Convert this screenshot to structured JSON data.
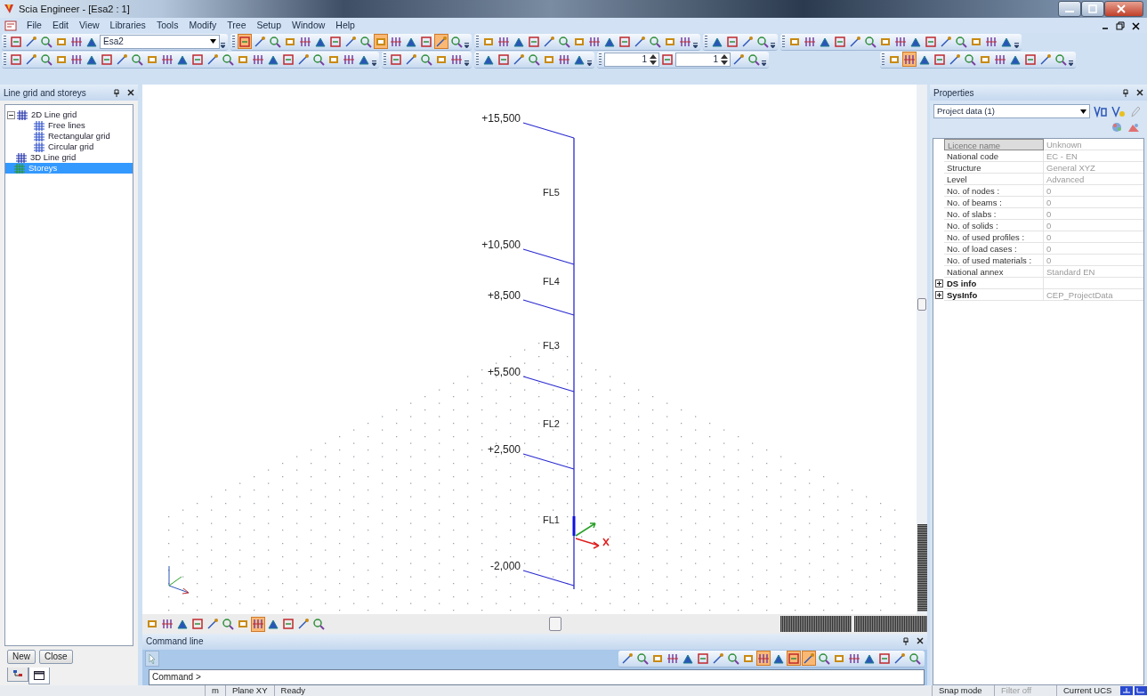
{
  "window": {
    "title": "Scia Engineer - [Esa2 : 1]"
  },
  "menu": [
    "File",
    "Edit",
    "View",
    "Libraries",
    "Tools",
    "Modify",
    "Tree",
    "Setup",
    "Window",
    "Help"
  ],
  "toolbar_rows": [
    {
      "groups": [
        {
          "items": [
            {
              "kind": "button",
              "on": false
            },
            {
              "kind": "button",
              "on": false
            },
            {
              "kind": "button",
              "on": false
            },
            {
              "kind": "button",
              "on": false
            },
            {
              "kind": "button",
              "on": false
            },
            {
              "kind": "button",
              "on": false
            },
            {
              "kind": "combo",
              "value": "Esa2"
            }
          ]
        },
        {
          "items": [
            {
              "kind": "button",
              "on": true
            },
            {
              "kind": "button",
              "on": false
            },
            {
              "kind": "button",
              "on": false
            },
            {
              "kind": "button",
              "on": false
            },
            {
              "kind": "button",
              "on": false
            },
            {
              "kind": "button",
              "on": false
            },
            {
              "kind": "button",
              "on": false
            },
            {
              "kind": "button",
              "on": false
            },
            {
              "kind": "button",
              "on": false
            },
            {
              "kind": "button",
              "on": true
            },
            {
              "kind": "button",
              "on": false
            },
            {
              "kind": "button",
              "on": false
            },
            {
              "kind": "button",
              "on": false
            },
            {
              "kind": "button",
              "on": true
            },
            {
              "kind": "button",
              "on": false
            }
          ]
        },
        {
          "items": [
            {
              "kind": "button",
              "on": false
            },
            {
              "kind": "button",
              "on": false
            },
            {
              "kind": "button",
              "on": false
            },
            {
              "kind": "button",
              "on": false
            },
            {
              "kind": "button",
              "on": false
            },
            {
              "kind": "button",
              "on": false
            },
            {
              "kind": "button",
              "on": false
            },
            {
              "kind": "button",
              "on": false
            },
            {
              "kind": "button",
              "on": false
            },
            {
              "kind": "button",
              "on": false
            },
            {
              "kind": "button",
              "on": false
            },
            {
              "kind": "button",
              "on": false
            },
            {
              "kind": "button",
              "on": false
            },
            {
              "kind": "button",
              "on": false
            }
          ]
        },
        {
          "items": [
            {
              "kind": "button",
              "on": false
            },
            {
              "kind": "button",
              "on": false
            },
            {
              "kind": "button",
              "on": false
            },
            {
              "kind": "button",
              "on": false
            }
          ]
        },
        {
          "items": [
            {
              "kind": "button",
              "on": false
            },
            {
              "kind": "button",
              "on": false
            },
            {
              "kind": "button",
              "on": false
            },
            {
              "kind": "button",
              "on": false
            },
            {
              "kind": "button",
              "on": false
            },
            {
              "kind": "button",
              "on": false
            },
            {
              "kind": "button",
              "on": false
            },
            {
              "kind": "button",
              "on": false
            },
            {
              "kind": "button",
              "on": false
            },
            {
              "kind": "button",
              "on": false
            },
            {
              "kind": "button",
              "on": false
            },
            {
              "kind": "button",
              "on": false
            },
            {
              "kind": "button",
              "on": false
            },
            {
              "kind": "button",
              "on": false
            },
            {
              "kind": "button",
              "on": false
            }
          ]
        }
      ]
    },
    {
      "groups": [
        {
          "items": [
            {
              "kind": "button",
              "on": false
            },
            {
              "kind": "button",
              "on": false
            },
            {
              "kind": "button",
              "on": false
            },
            {
              "kind": "button",
              "on": false
            },
            {
              "kind": "button",
              "on": false
            },
            {
              "kind": "button",
              "on": false
            },
            {
              "kind": "button",
              "on": false
            },
            {
              "kind": "button",
              "on": false
            },
            {
              "kind": "button",
              "on": false
            },
            {
              "kind": "button",
              "on": false
            },
            {
              "kind": "button",
              "on": false
            },
            {
              "kind": "button",
              "on": false
            },
            {
              "kind": "button",
              "on": false
            },
            {
              "kind": "button",
              "on": false
            },
            {
              "kind": "button",
              "on": false
            },
            {
              "kind": "button",
              "on": false
            },
            {
              "kind": "button",
              "on": false
            },
            {
              "kind": "button",
              "on": false
            },
            {
              "kind": "button",
              "on": false
            },
            {
              "kind": "button",
              "on": false
            },
            {
              "kind": "button",
              "on": false
            },
            {
              "kind": "button",
              "on": false
            },
            {
              "kind": "button",
              "on": false
            },
            {
              "kind": "button",
              "on": false
            }
          ]
        },
        {
          "items": [
            {
              "kind": "button",
              "on": false
            },
            {
              "kind": "button",
              "on": false
            },
            {
              "kind": "button",
              "on": false
            },
            {
              "kind": "button",
              "on": false
            },
            {
              "kind": "button",
              "on": false
            }
          ]
        },
        {
          "items": [
            {
              "kind": "button",
              "on": false
            },
            {
              "kind": "button",
              "on": false
            },
            {
              "kind": "button",
              "on": false
            },
            {
              "kind": "button",
              "on": false
            },
            {
              "kind": "button",
              "on": false
            },
            {
              "kind": "button",
              "on": false
            },
            {
              "kind": "button",
              "on": false
            }
          ]
        },
        {
          "items": [
            {
              "kind": "spinner",
              "value": "1"
            },
            {
              "kind": "button",
              "on": false
            },
            {
              "kind": "spinner",
              "value": "1"
            },
            {
              "kind": "button",
              "on": false
            },
            {
              "kind": "button",
              "on": false
            }
          ]
        },
        {
          "items": [
            {
              "kind": "button",
              "on": false
            },
            {
              "kind": "button",
              "on": true
            },
            {
              "kind": "button",
              "on": false
            },
            {
              "kind": "button",
              "on": false
            },
            {
              "kind": "button",
              "on": false
            },
            {
              "kind": "button",
              "on": false
            },
            {
              "kind": "button",
              "on": false
            },
            {
              "kind": "button",
              "on": false
            },
            {
              "kind": "button",
              "on": false
            },
            {
              "kind": "button",
              "on": false
            },
            {
              "kind": "button",
              "on": false
            },
            {
              "kind": "button",
              "on": false
            }
          ]
        }
      ]
    }
  ],
  "left_panel": {
    "title": "Line grid and storeys",
    "tree": [
      {
        "label": "2D Line grid",
        "expanded": true,
        "selected": false,
        "children": [
          {
            "label": "Free lines",
            "selected": false
          },
          {
            "label": "Rectangular grid",
            "selected": false
          },
          {
            "label": "Circular grid",
            "selected": false
          }
        ]
      },
      {
        "label": "3D Line grid",
        "selected": false
      },
      {
        "label": "Storeys",
        "selected": true
      }
    ],
    "buttons": [
      "New",
      "Close"
    ],
    "tabs": [
      {
        "selected": false
      },
      {
        "selected": true
      }
    ]
  },
  "canvas": {
    "levels": [
      {
        "elevation": "+15,500"
      },
      {
        "elevation": "+10,500"
      },
      {
        "elevation": "+8,500"
      },
      {
        "elevation": "+5,500"
      },
      {
        "elevation": "+2,500"
      },
      {
        "elevation": "-2,000"
      }
    ],
    "storeys": [
      "FL5",
      "FL4",
      "FL3",
      "FL2",
      "FL1"
    ],
    "bottom_toolbar": [
      {
        "on": false
      },
      {
        "on": false
      },
      {
        "on": false
      },
      {
        "on": false
      },
      {
        "on": false
      },
      {
        "on": false
      },
      {
        "on": false
      },
      {
        "on": true
      },
      {
        "on": false
      },
      {
        "on": false
      },
      {
        "on": false
      },
      {
        "on": false
      }
    ]
  },
  "command_line": {
    "title": "Command line",
    "prompt": "Command >",
    "tools": [
      {
        "on": false
      },
      {
        "on": false
      },
      {
        "on": false
      },
      {
        "on": false
      },
      {
        "on": false
      },
      {
        "on": false
      },
      {
        "on": false
      },
      {
        "on": false
      },
      {
        "on": false
      },
      {
        "on": true
      },
      {
        "on": false
      },
      {
        "on": true
      },
      {
        "on": true
      },
      {
        "on": false
      },
      {
        "on": false
      },
      {
        "on": false
      },
      {
        "on": false
      },
      {
        "on": false
      },
      {
        "on": false
      },
      {
        "on": false
      }
    ]
  },
  "properties": {
    "title": "Properties",
    "selector": "Project data (1)",
    "rows": [
      {
        "kind": "property",
        "name": "Licence name",
        "value": "Unknown",
        "selected": true
      },
      {
        "kind": "property",
        "name": "National code",
        "value": "EC - EN",
        "selected": false
      },
      {
        "kind": "property",
        "name": "Structure",
        "value": "General XYZ",
        "selected": false
      },
      {
        "kind": "property",
        "name": "Level",
        "value": "Advanced",
        "selected": false
      },
      {
        "kind": "property",
        "name": "No. of nodes :",
        "value": "0",
        "selected": false
      },
      {
        "kind": "property",
        "name": "No. of beams :",
        "value": "0",
        "selected": false
      },
      {
        "kind": "property",
        "name": "No. of slabs :",
        "value": "0",
        "selected": false
      },
      {
        "kind": "property",
        "name": "No. of solids :",
        "value": "0",
        "selected": false
      },
      {
        "kind": "property",
        "name": "No. of used profiles :",
        "value": "0",
        "selected": false
      },
      {
        "kind": "property",
        "name": "No. of load cases :",
        "value": "0",
        "selected": false
      },
      {
        "kind": "property",
        "name": "No. of used materials :",
        "value": "0",
        "selected": false
      },
      {
        "kind": "property",
        "name": "National annex",
        "value": "Standard EN",
        "selected": false
      },
      {
        "kind": "group",
        "name": "DS info",
        "expanded": false,
        "selected": false
      },
      {
        "kind": "group",
        "name": "SysInfo",
        "value": "CEP_ProjectData",
        "expanded": false,
        "selected": false
      }
    ]
  },
  "status_bar": {
    "left": [
      {
        "text": "m",
        "disabled": false
      },
      {
        "text": "Plane XY",
        "disabled": false
      },
      {
        "text": "Ready",
        "disabled": false
      }
    ],
    "right": [
      {
        "text": "Snap mode",
        "disabled": false
      },
      {
        "text": "Filter off",
        "disabled": true
      },
      {
        "text": "Current UCS",
        "disabled": false
      }
    ]
  }
}
